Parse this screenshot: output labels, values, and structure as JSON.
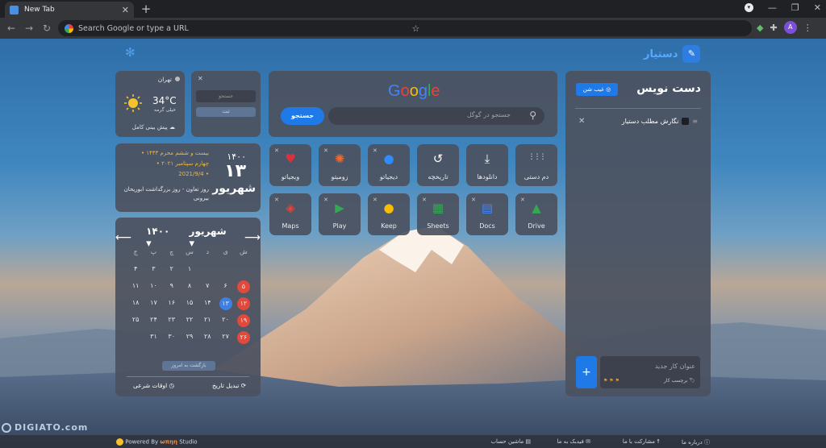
{
  "browser": {
    "tab_title": "New Tab",
    "omnibox_placeholder": "Search Google or type a URL",
    "profile_initial": "A"
  },
  "app": {
    "logo_text": "دستیار"
  },
  "weather": {
    "city": "تهران",
    "temp": "34°C",
    "desc": "خیلی گرمه",
    "forecast_link": "پیش بینی کامل"
  },
  "quick_note": {
    "input_placeholder": "جستجو",
    "submit_label": "ثبت"
  },
  "date": {
    "year": "۱۴۰۰",
    "day": "۱۳",
    "month": "شهریور",
    "hijri": "بیست و ششم محرم ۱۴۴۳",
    "gregorian_text": "چهارم سپتامبر ۲۰۲۱",
    "gregorian_num": "2021/9/4",
    "event": "روز تعاون - روز بزرگداشت ابوریحان بیرونی"
  },
  "calendar": {
    "month_label": "شهریور",
    "year_label": "۱۴۰۰",
    "weekdays": [
      "ش",
      "ی",
      "د",
      "س",
      "چ",
      "پ",
      "ج"
    ],
    "rows": [
      [
        "",
        "",
        "",
        "۱",
        "۲",
        "۳",
        "۴"
      ],
      [
        "۵",
        "۶",
        "۷",
        "۸",
        "۹",
        "۱۰",
        "۱۱"
      ],
      [
        "۱۲",
        "۱۳",
        "۱۴",
        "۱۵",
        "۱۶",
        "۱۷",
        "۱۸"
      ],
      [
        "۱۹",
        "۲۰",
        "۲۱",
        "۲۲",
        "۲۳",
        "۲۴",
        "۲۵"
      ],
      [
        "۲۶",
        "۲۷",
        "۲۸",
        "۲۹",
        "۳۰",
        "۳۱",
        ""
      ]
    ],
    "holidays": [
      "۵",
      "۱۲",
      "۱۹",
      "۲۶"
    ],
    "today": "۱۳",
    "back_to_today": "بازگشت به امروز",
    "convert_date": "تبدیل تاریخ",
    "prayer_times": "اوقات شرعی"
  },
  "search": {
    "logo": "Google",
    "placeholder": "جستجو در گوگل",
    "button": "جستجو"
  },
  "shortcuts_row1": [
    {
      "label": "دم دستی",
      "icon": "grid-icon",
      "closable": false
    },
    {
      "label": "دانلودها",
      "icon": "download-icon",
      "closable": false
    },
    {
      "label": "تاریخچه",
      "icon": "history-icon",
      "closable": false
    },
    {
      "label": "دیجیاتو",
      "icon": "digiato-icon",
      "closable": true
    },
    {
      "label": "زومیتو",
      "icon": "zoomit-icon",
      "closable": true
    },
    {
      "label": "ویجیاتو",
      "icon": "vigiato-icon",
      "closable": true
    }
  ],
  "shortcuts_row2": [
    {
      "label": "Drive",
      "icon": "drive-icon",
      "closable": true
    },
    {
      "label": "Docs",
      "icon": "docs-icon",
      "closable": true
    },
    {
      "label": "Sheets",
      "icon": "sheets-icon",
      "closable": true
    },
    {
      "label": "Keep",
      "icon": "keep-icon",
      "closable": true
    },
    {
      "label": "Play",
      "icon": "play-icon",
      "closable": true
    },
    {
      "label": "Maps",
      "icon": "maps-icon",
      "closable": true
    }
  ],
  "notes": {
    "title": "دست نویس",
    "hide_button": "غیب شن",
    "items": [
      "نگارش مطلب دستیار"
    ],
    "new_placeholder": "عنوان کار جدید",
    "tag_label": "برچسب کار"
  },
  "footer": {
    "powered": "Powered By",
    "studio_brand": "‮‬",
    "studio": "Studio",
    "about": "درباره ما",
    "contribute": "مشارکت با ما",
    "feedback": "فیدبک به ما",
    "calculator": "ماشین حساب"
  },
  "watermark": "DIGIATO.com",
  "colors": {
    "accent": "#1f7ae8",
    "holiday": "#e04a3c",
    "today": "#3f7fe0",
    "hijri": "#f0b840"
  }
}
